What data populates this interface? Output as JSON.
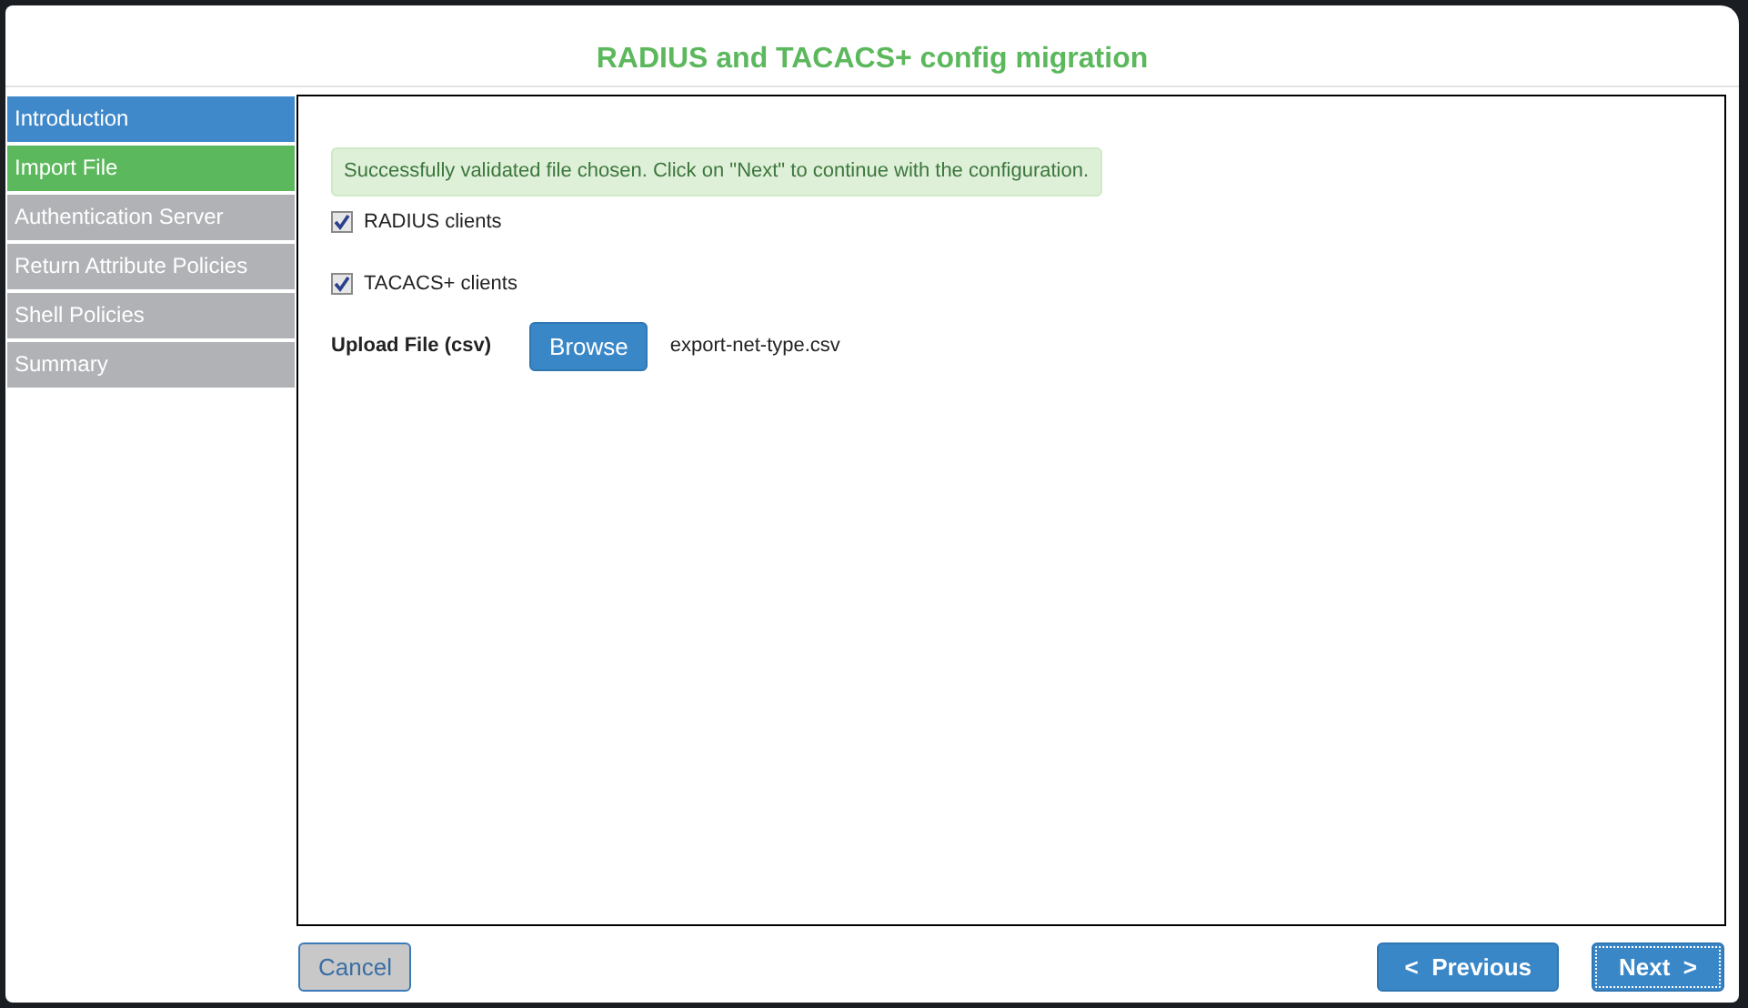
{
  "dialog": {
    "title": "RADIUS and TACACS+ config migration"
  },
  "steps": [
    {
      "label": "Introduction",
      "completed": true,
      "selected": false
    },
    {
      "label": "Import File",
      "completed": false,
      "selected": true
    },
    {
      "label": "Authentication Server",
      "completed": false,
      "selected": false
    },
    {
      "label": "Return Attribute Policies",
      "completed": false,
      "selected": false
    },
    {
      "label": "Shell Policies",
      "completed": false,
      "selected": false
    },
    {
      "label": "Summary",
      "completed": false,
      "selected": false
    }
  ],
  "alert": "Successfully validated file chosen. Click on \"Next\" to continue with the configuration.",
  "options": [
    {
      "label": "RADIUS clients",
      "checked": true
    },
    {
      "label": "TACACS+ clients",
      "checked": true
    }
  ],
  "upload": {
    "label": "Upload File (csv)",
    "button": "Browse",
    "file": "export-net-type.csv"
  },
  "footer": {
    "cancel": "Cancel",
    "previous": "<  Previous",
    "next": "Next  >",
    "next_focused": true
  }
}
